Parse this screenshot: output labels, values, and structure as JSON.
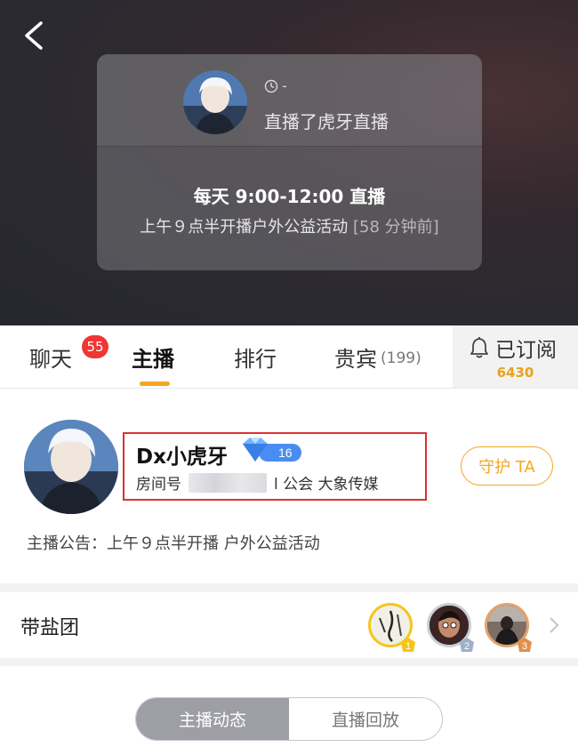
{
  "header": {
    "back_icon": "chevron-left-icon"
  },
  "live_card": {
    "time_text": "-",
    "action": "直播了虎牙直播",
    "schedule": "每天 9:00-12:00 直播",
    "desc": "上午９点半开播户外公益活动",
    "ago": "[58 分钟前]"
  },
  "tabs": {
    "items": [
      {
        "label": "聊天"
      },
      {
        "label": "主播"
      },
      {
        "label": "排行"
      },
      {
        "label": "贵宾",
        "count": "(199)"
      }
    ],
    "chat_badge": "55",
    "active": "主播",
    "accent_color": "#f5a623"
  },
  "subscribe": {
    "label": "已订阅",
    "count": "6430",
    "icon": "bell-icon"
  },
  "anchor": {
    "name": "Dx小虎牙",
    "level": "16",
    "room_label": "房间号",
    "guild": "l 公会 大象传媒",
    "guard_label": "守护 TA",
    "announcement": "主播公告：上午９点半开播 户外公益活动"
  },
  "fan_group": {
    "label": "带盐团",
    "ranks": [
      "1",
      "2",
      "3"
    ]
  },
  "segment": {
    "options": [
      "主播动态",
      "直播回放"
    ],
    "active": "主播动态"
  }
}
